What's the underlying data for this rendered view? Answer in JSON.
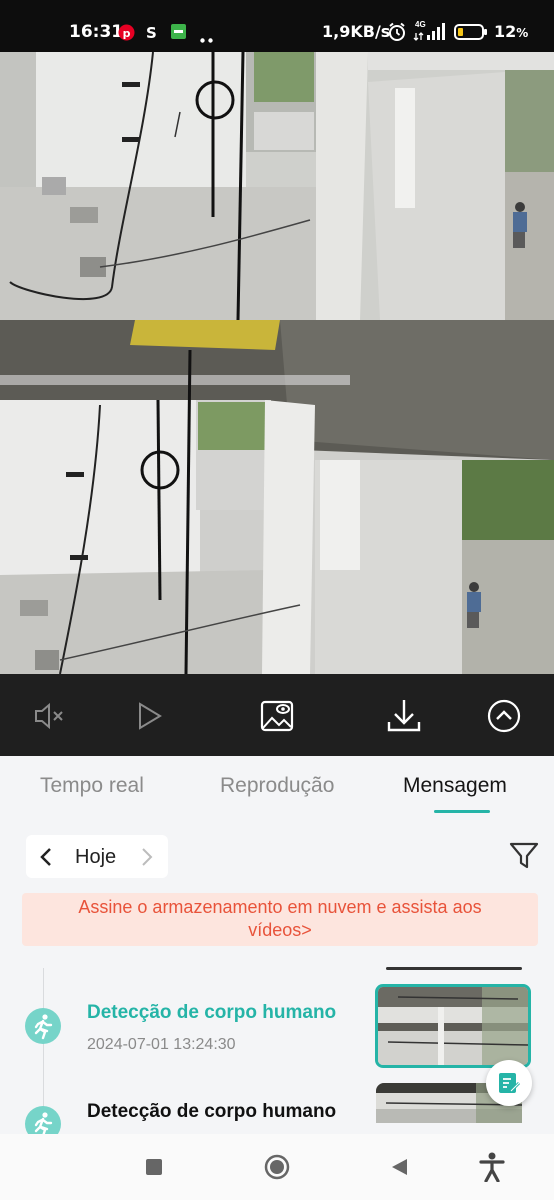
{
  "status_bar": {
    "time": "16:31",
    "left_icons": [
      "pinterest-icon",
      "s-app-icon",
      "green-app-icon",
      "more-dots-icon"
    ],
    "network_speed": "1,9KB/s",
    "network_type": "4G",
    "battery_percent": "12",
    "battery_suffix": "%"
  },
  "camera": {
    "controls": [
      "mute-icon",
      "play-icon",
      "snapshot-icon",
      "download-icon",
      "collapse-up-icon"
    ]
  },
  "tabs": [
    {
      "label": "Tempo real",
      "active": false
    },
    {
      "label": "Reprodução",
      "active": false
    },
    {
      "label": "Mensagem",
      "active": true
    }
  ],
  "date_selector": {
    "label": "Hoje"
  },
  "banner": {
    "line1": "Assine o armazenamento em nuvem e assista aos",
    "line2": "vídeos>"
  },
  "events": [
    {
      "title": "Detecção de corpo humano",
      "time": "2024-07-01 13:24:30",
      "highlighted": true
    },
    {
      "title": "Detecção de corpo humano",
      "highlighted": false
    }
  ],
  "colors": {
    "accent": "#25b4a7",
    "banner_text": "#e8533a",
    "banner_bg": "#fde5de",
    "event_dot": "#76d4c9"
  }
}
